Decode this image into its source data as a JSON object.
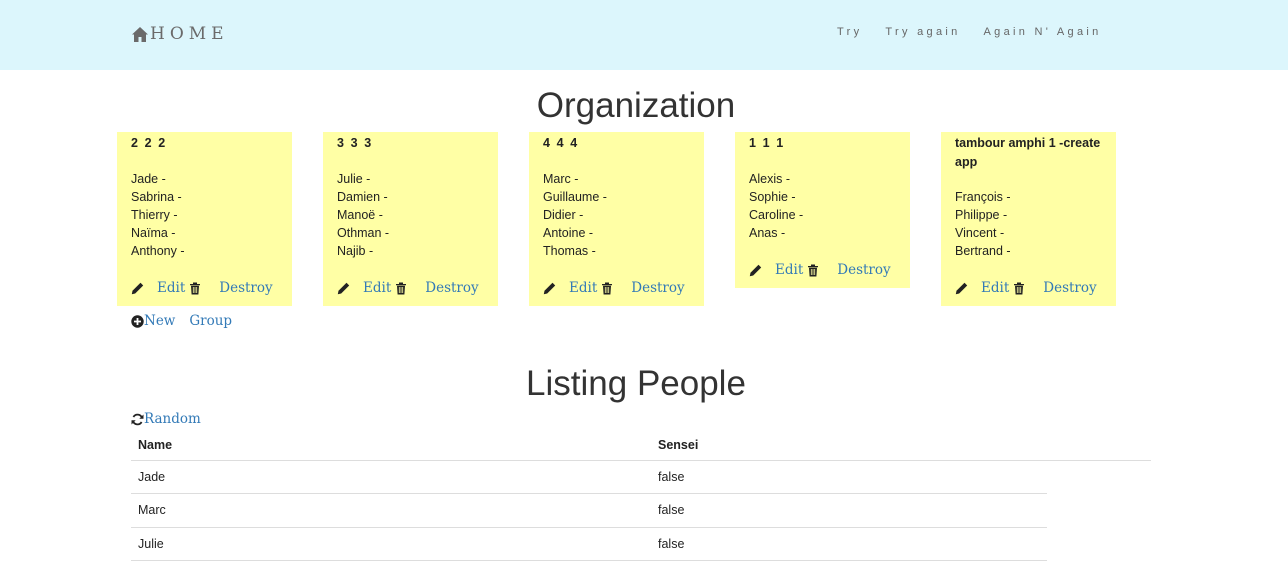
{
  "navbar": {
    "brand_label": "HOME",
    "links": [
      "Try",
      "Try again",
      "Again N' Again"
    ]
  },
  "organization": {
    "title": "Organization",
    "groups": [
      {
        "name": "2 2 2",
        "members": [
          "Jade -",
          "Sabrina -",
          "Thierry -",
          "Naïma -",
          "Anthony -"
        ],
        "edit_label": "Edit",
        "destroy_label": "Destroy"
      },
      {
        "name": "3 3 3",
        "members": [
          "Julie -",
          "Damien -",
          "Manoë -",
          "Othman -",
          "Najib -"
        ],
        "edit_label": "Edit",
        "destroy_label": "Destroy"
      },
      {
        "name": "4 4 4",
        "members": [
          "Marc -",
          "Guillaume -",
          "Didier -",
          "Antoine -",
          "Thomas -"
        ],
        "edit_label": "Edit",
        "destroy_label": "Destroy"
      },
      {
        "name": "1 1 1",
        "members": [
          "Alexis -",
          "Sophie -",
          "Caroline -",
          "Anas -"
        ],
        "edit_label": "Edit",
        "destroy_label": "Destroy"
      },
      {
        "name": "tambour amphi 1 -create app",
        "members": [
          "François -",
          "Philippe -",
          "Vincent -",
          "Bertrand -"
        ],
        "edit_label": "Edit",
        "destroy_label": "Destroy"
      }
    ],
    "new_group": {
      "word1": "New",
      "word2": "Group"
    }
  },
  "people": {
    "title": "Listing People",
    "random_label": "Random",
    "columns": [
      "Name",
      "Sensei"
    ],
    "rows": [
      [
        "Jade",
        "false"
      ],
      [
        "Marc",
        "false"
      ],
      [
        "Julie",
        "false"
      ]
    ]
  },
  "colors": {
    "navbar_bg": "#dcf6fc",
    "card_bg": "#ffffa5",
    "link": "#337ab7"
  },
  "icons": [
    "home-icon",
    "pencil-icon",
    "trash-icon",
    "plus-circle-icon",
    "refresh-icon"
  ]
}
